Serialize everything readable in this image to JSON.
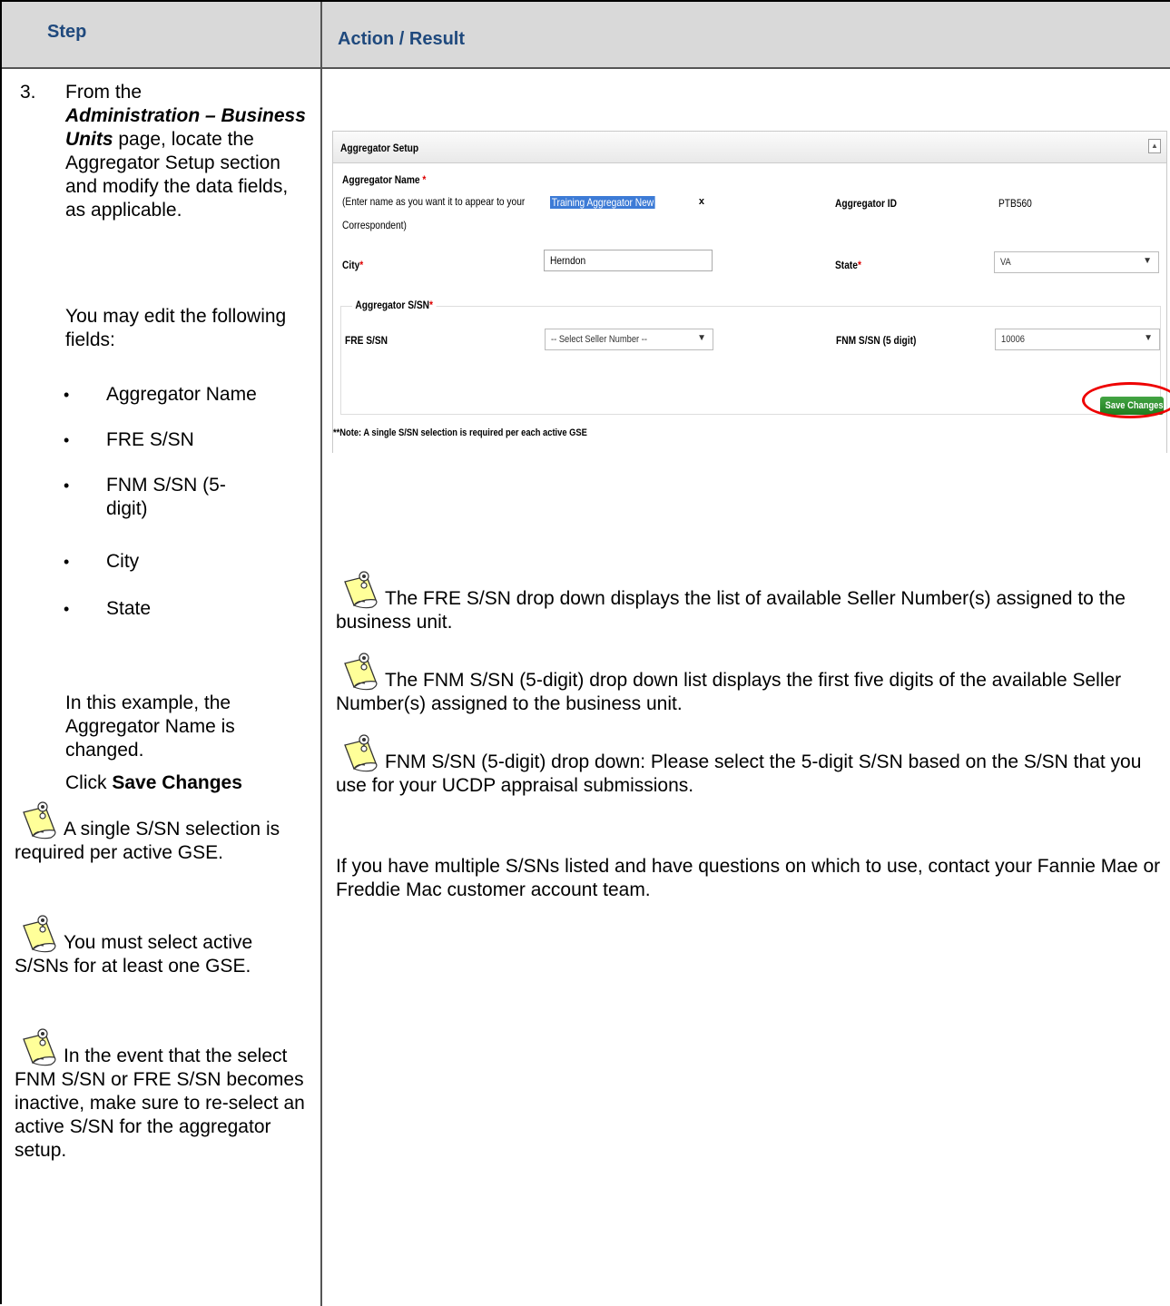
{
  "header": {
    "step": "Step",
    "action": "Action / Result"
  },
  "left": {
    "step_number": "3.",
    "instruction_pre": "From the",
    "instruction_page": "Administration – Business Units",
    "instruction_post": "page, locate the Aggregator Setup section and modify the data fields, as applicable.",
    "edit_intro": "You may edit the following fields:",
    "fields": [
      "Aggregator Name",
      "FRE S/SN",
      "FNM S/SN (5-",
      "digit)",
      "City",
      "State"
    ],
    "example": "In this example, the Aggregator Name is changed.",
    "click_pre": "Click",
    "click_bold": "Save Changes",
    "notes": [
      "A single S/SN selection is required per active GSE.",
      "You must select active S/SNs for at least one GSE.",
      "In the event that the select FNM S/SN or FRE S/SN becomes inactive, make sure to re-select an active S/SN for the aggregator setup."
    ]
  },
  "screenshot": {
    "panel_title": "Aggregator Setup",
    "name_label": "Aggregator Name",
    "name_hint_1": "(Enter name as you want it to appear to your",
    "name_hint_2": "Correspondent)",
    "name_value": "Training Aggregator New",
    "clear": "x",
    "id_label": "Aggregator ID",
    "id_value": "PTB560",
    "city_label": "City",
    "city_value": "Herndon",
    "state_label": "State",
    "state_value": "VA",
    "group_label": "Aggregator S/SN",
    "fre_label": "FRE S/SN",
    "fre_value": "-- Select Seller Number --",
    "fnm_label": "FNM S/SN (5 digit)",
    "fnm_value": "10006",
    "save_button": "Save Changes",
    "note": "**Note: A single S/SN selection is required per each active GSE"
  },
  "right": {
    "note1": "The FRE S/SN drop down displays the list of available Seller Number(s) assigned to the business unit.",
    "note2": "The FNM S/SN (5-digit) drop down list displays the first five digits of the available Seller Number(s) assigned to the business unit.",
    "note3": "FNM S/SN (5-digit) drop down: Please select the 5-digit S/SN based on the S/SN that you use for your UCDP appraisal submissions.",
    "para": "If you have multiple S/SNs listed and have questions on which to use, contact your Fannie Mae or Freddie Mac customer account team."
  }
}
